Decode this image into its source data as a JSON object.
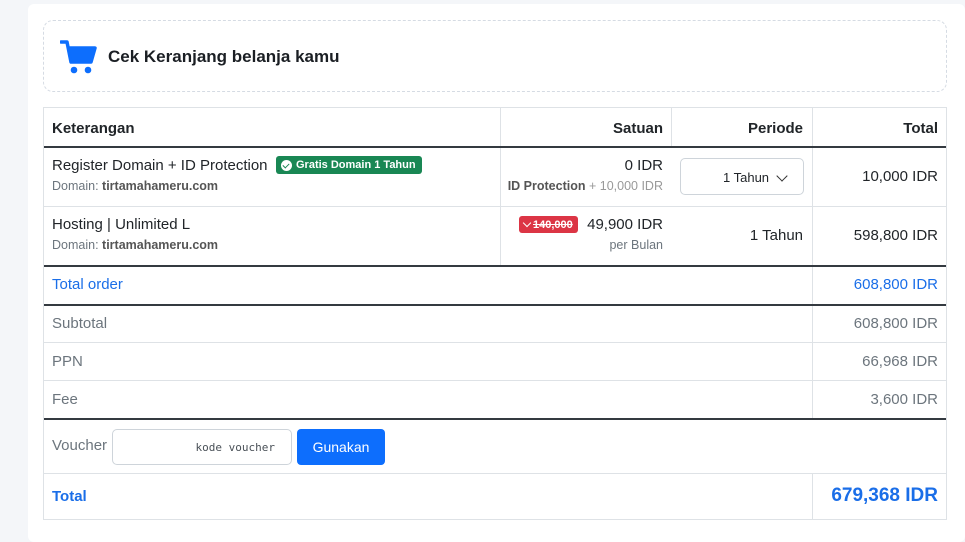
{
  "header": {
    "title": "Cek Keranjang belanja kamu",
    "icon": "shopping-cart-icon",
    "icon_color": "#0d6efd"
  },
  "table": {
    "columns": [
      "Keterangan",
      "Satuan",
      "Periode",
      "Total"
    ],
    "items": [
      {
        "name": "Register Domain + ID Protection",
        "badge": "Gratis Domain 1 Tahun",
        "domain_label": "Domain:",
        "domain": "tirtamahameru.com",
        "price": "0 IDR",
        "extra_label": "ID Protection",
        "extra_value": "+ 10,000 IDR",
        "period": "1 Tahun",
        "total": "10,000 IDR"
      },
      {
        "name": "Hosting | Unlimited L",
        "domain_label": "Domain:",
        "domain": "tirtamahameru.com",
        "old_price": "140,000",
        "price": "49,900 IDR",
        "price_unit": "per Bulan",
        "period": "1 Tahun",
        "total": "598,800 IDR"
      }
    ],
    "total_order_label": "Total order",
    "total_order_value": "608,800 IDR",
    "subtotal_label": "Subtotal",
    "subtotal_value": "608,800 IDR",
    "ppn_label": "PPN",
    "ppn_value": "66,968 IDR",
    "fee_label": "Fee",
    "fee_value": "3,600 IDR",
    "voucher_label": "Voucher",
    "voucher_placeholder": "kode voucher",
    "voucher_button": "Gunakan",
    "grand_total_label": "Total",
    "grand_total_value": "679,368 IDR"
  },
  "colors": {
    "accent": "#0d6efd",
    "link": "#1a6ee8",
    "success": "#198754",
    "danger": "#dc3545"
  }
}
